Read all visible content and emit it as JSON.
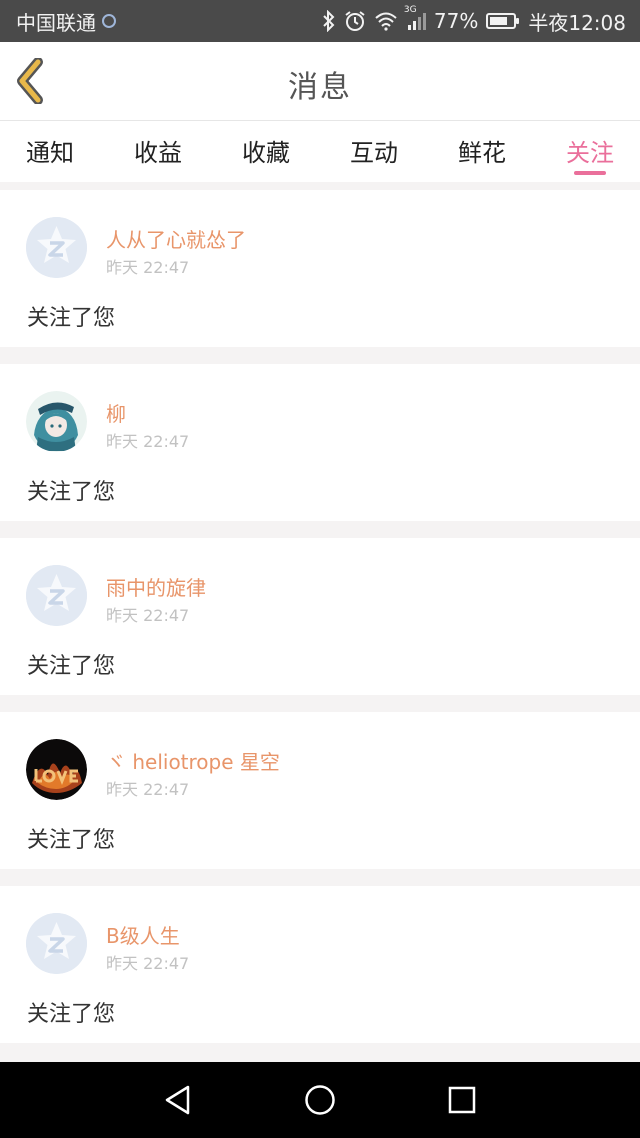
{
  "status_bar": {
    "carrier": "中国联通",
    "network": "3G",
    "battery": "77%",
    "battery_level": 0.77,
    "time": "半夜12:08"
  },
  "header": {
    "title": "消息"
  },
  "tabs": [
    {
      "label": "通知",
      "active": false
    },
    {
      "label": "收益",
      "active": false
    },
    {
      "label": "收藏",
      "active": false
    },
    {
      "label": "互动",
      "active": false
    },
    {
      "label": "鲜花",
      "active": false
    },
    {
      "label": "关注",
      "active": true
    }
  ],
  "notifications": [
    {
      "user": "人从了心就怂了",
      "time": "昨天 22:47",
      "message": "关注了您",
      "avatar": "default-avatar-icon"
    },
    {
      "user": "柳",
      "time": "昨天 22:47",
      "message": "关注了您",
      "avatar": "anime-girl-avatar"
    },
    {
      "user": "雨中的旋律",
      "time": "昨天 22:47",
      "message": "关注了您",
      "avatar": "default-avatar-icon"
    },
    {
      "user": "ヾ heliotrope 星空",
      "time": "昨天 22:47",
      "message": "关注了您",
      "avatar": "fire-love-avatar"
    },
    {
      "user": "B级人生",
      "time": "昨天 22:47",
      "message": "关注了您",
      "avatar": "default-avatar-icon"
    }
  ],
  "colors": {
    "accent": "#ea6f9b",
    "username": "#e8956a",
    "back_icon": "#e8b84a"
  }
}
